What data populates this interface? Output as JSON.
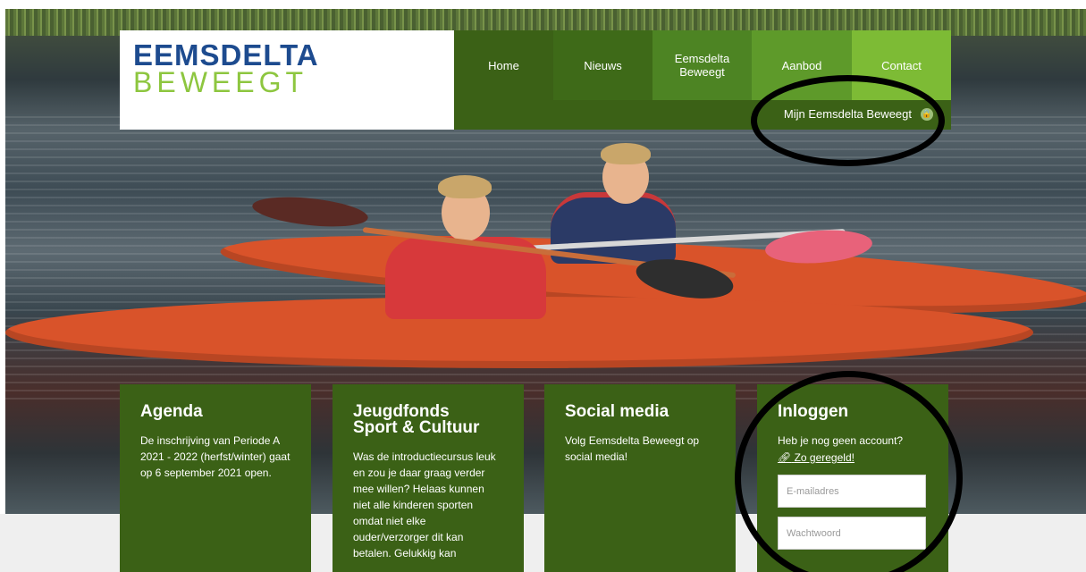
{
  "header": {
    "logo_line1": "EEMSDELTA",
    "logo_line2": "BEWEEGT",
    "nav": [
      {
        "label": "Home"
      },
      {
        "label": "Nieuws"
      },
      {
        "label": "Eemsdelta Beweegt"
      },
      {
        "label": "Aanbod"
      },
      {
        "label": "Contact"
      }
    ],
    "account_link": "Mijn Eemsdelta Beweegt",
    "account_icon": "lock-icon"
  },
  "cards": {
    "agenda": {
      "title": "Agenda",
      "text": "De inschrijving van Periode A 2021 - 2022 (herfst/winter) gaat op 6 september 2021 open."
    },
    "jeugdfonds": {
      "title": "Jeugdfonds Sport & Cultuur",
      "text": "Was de introductiecursus leuk en zou je daar graag verder mee willen? Helaas kunnen niet alle kinderen sporten omdat niet elke ouder/verzorger dit kan betalen. Gelukkig kan"
    },
    "social": {
      "title": "Social media",
      "text": "Volg Eemsdelta Beweegt op social media!"
    },
    "login": {
      "title": "Inloggen",
      "question": "Heb je nog geen account?",
      "signup_label": "Zo geregeld!",
      "email_placeholder": "E-mailadres",
      "password_placeholder": "Wachtwoord"
    }
  },
  "colors": {
    "dark_green": "#3b6116",
    "light_green": "#7dbb35",
    "logo_blue": "#1d4b8f",
    "logo_green": "#8dc63f"
  }
}
